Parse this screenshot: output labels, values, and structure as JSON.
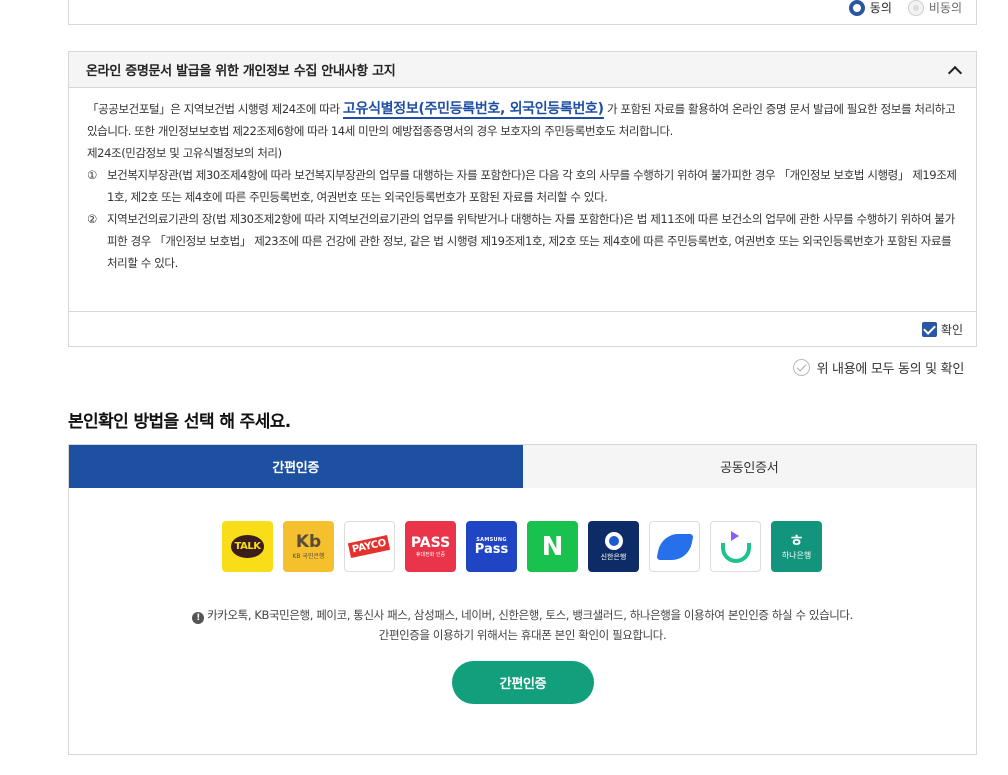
{
  "top_consent": {
    "agree_label": "동의",
    "disagree_label": "비동의",
    "selected": "agree"
  },
  "notice": {
    "title": "온라인 증명문서 발급을 위한 개인정보 수집 안내사항 고지",
    "para1_pre": "「공공보건포털」은 지역보건법 시행령 제24조에 따라 ",
    "para1_highlight": "고유식별정보(주민등록번호, 외국인등록번호)",
    "para1_post": " 가 포함된 자료를 활용하여 온라인 증명 문서 발급에 필요한 정보를 처리하고 있습니다. 또한 개인정보보호법 제22조제6항에 따라 14세 미만의 예방접종증명서의 경우 보호자의 주민등록번호도 처리합니다.",
    "article_title": "제24조(민감정보 및 고유식별정보의 처리)",
    "items": [
      {
        "num": "①",
        "text": "보건복지부장관(법 제30조제4항에 따라 보건복지부장관의 업무를 대행하는 자를 포함한다)은 다음 각 호의 사무를 수행하기 위하여 불가피한 경우 「개인정보 보호법 시행령」 제19조제1호, 제2호 또는 제4호에 따른 주민등록번호, 여권번호 또는 외국인등록번호가 포함된 자료를 처리할 수 있다."
      },
      {
        "num": "②",
        "text": "지역보건의료기관의 장(법 제30조제2항에 따라 지역보건의료기관의 업무를 위탁받거나 대행하는 자를 포함한다)은 법 제11조에 따른 보건소의 업무에 관한 사무를 수행하기 위하여 불가피한 경우 「개인정보 보호법」 제23조에 따른 건강에 관한 정보, 같은 법 시행령 제19조제1호, 제2호 또는 제4호에 따른 주민등록번호, 여권번호 또는 외국인등록번호가 포함된 자료를 처리할 수 있다."
      }
    ],
    "confirm_label": "확인",
    "confirm_checked": true
  },
  "agree_all_label": "위 내용에 모두 동의 및 확인",
  "section_title": "본인확인 방법을 선택 해 주세요.",
  "tabs": [
    {
      "label": "간편인증",
      "active": true
    },
    {
      "label": "공동인증서",
      "active": false
    }
  ],
  "providers": [
    {
      "name": "kakao",
      "text": "TALK"
    },
    {
      "name": "kb",
      "text": "Kb",
      "sub": "KB 국민은행"
    },
    {
      "name": "payco",
      "text": "PAYCO"
    },
    {
      "name": "pass",
      "text": "PASS",
      "sub": "휴대전화 인증"
    },
    {
      "name": "samsung-pass",
      "text": "Pass",
      "sub": "SAMSUNG"
    },
    {
      "name": "naver",
      "text": "N"
    },
    {
      "name": "shinhan",
      "sub": "신한은행"
    },
    {
      "name": "toss"
    },
    {
      "name": "banksalad"
    },
    {
      "name": "hana",
      "text": "ㅎ",
      "sub": "하나은행"
    }
  ],
  "info_line1": "카카오톡, KB국민은행, 페이코, 통신사 패스, 삼성패스, 네이버, 신한은행, 토스, 뱅크샐러드, 하나은행을 이용하여 본인인증 하실 수 있습니다.",
  "info_line2": "간편인증을 이용하기 위해서는 휴대폰 본인 확인이 필요합니다.",
  "auth_button_label": "간편인증",
  "colors": {
    "primary_blue": "#1e50a2",
    "auth_green": "#12a07c"
  }
}
